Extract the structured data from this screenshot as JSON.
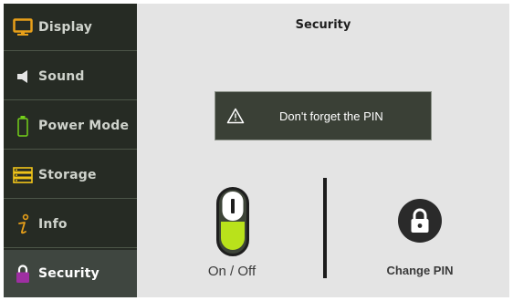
{
  "sidebar": {
    "items": [
      {
        "label": "Display",
        "icon": "monitor-icon",
        "active": false
      },
      {
        "label": "Sound",
        "icon": "speaker-icon",
        "active": false
      },
      {
        "label": "Power Mode",
        "icon": "battery-icon",
        "active": false
      },
      {
        "label": "Storage",
        "icon": "storage-icon",
        "active": false
      },
      {
        "label": "Info",
        "icon": "info-icon",
        "active": false
      },
      {
        "label": "Security",
        "icon": "lock-icon",
        "active": true
      }
    ]
  },
  "main": {
    "title": "Security",
    "banner": {
      "icon": "warning-icon",
      "message": "Don't forget the PIN"
    },
    "toggle": {
      "label": "On / Off",
      "state": "on",
      "icon": "toggle-switch-icon"
    },
    "change_pin": {
      "label": "Change PIN",
      "icon": "lock-icon"
    }
  },
  "colors": {
    "sidebar_bg": "#262b24",
    "sidebar_active_bg": "#3f4640",
    "panel_bg": "#e4e4e4",
    "accent_orange": "#e8a019",
    "accent_green": "#b9e21b",
    "accent_purple": "#9e2fa2",
    "banner_bg": "#3a4036"
  }
}
